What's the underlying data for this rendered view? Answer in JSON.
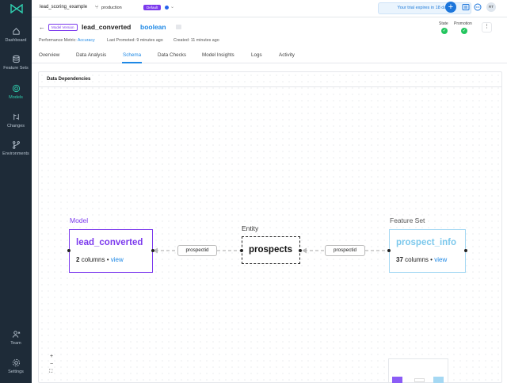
{
  "sidebar": {
    "items": [
      {
        "label": "Dashboard",
        "icon": "home-icon"
      },
      {
        "label": "Feature Sets",
        "icon": "database-icon"
      },
      {
        "label": "Models",
        "icon": "models-icon",
        "active": true
      },
      {
        "label": "Changes",
        "icon": "changes-icon"
      },
      {
        "label": "Environments",
        "icon": "branch-icon"
      },
      {
        "label": "Team",
        "icon": "team-icon"
      },
      {
        "label": "Settings",
        "icon": "gear-icon"
      }
    ]
  },
  "topbar": {
    "project": "lead_scoring_example",
    "branch": "production",
    "branch_badge": "Default",
    "trial": "Your trial expires in 18 days.",
    "plus": "+",
    "avatar": "RT"
  },
  "header": {
    "badge": "Model Version",
    "name": "lead_converted",
    "type": "boolean",
    "metric_label": "Performance Metric:",
    "metric_value": "Accuracy",
    "promoted_label": "Last Promoted:",
    "promoted_value": "9 minutes ago",
    "created_label": "Created:",
    "created_value": "11 minutes ago",
    "state_label": "State",
    "promotion_label": "Promotion",
    "more": "⋮"
  },
  "tabs": [
    "Overview",
    "Data Analysis",
    "Schema",
    "Data Checks",
    "Model Insights",
    "Logs",
    "Activity"
  ],
  "panel": {
    "title": "Data Dependencies",
    "model": {
      "label": "Model",
      "name": "lead_converted",
      "count": "2",
      "columns": "columns",
      "sep": "•",
      "link": "view"
    },
    "entity": {
      "label": "Entity",
      "name": "prospects"
    },
    "feature_set": {
      "label": "Feature Set",
      "name": "prospect_info",
      "count": "37",
      "columns": "columns",
      "sep": "•",
      "link": "view"
    },
    "edge_left": "prospectid",
    "edge_right": "prospectid",
    "zoom_in": "+",
    "zoom_out": "−",
    "fit": "⛶"
  },
  "colors": {
    "sidebar_bg": "#1e2b38",
    "active_nav": "#30d0b0",
    "model_border": "#7c3aed",
    "feature_border": "#a5d8f3",
    "link": "#1e88e5"
  }
}
